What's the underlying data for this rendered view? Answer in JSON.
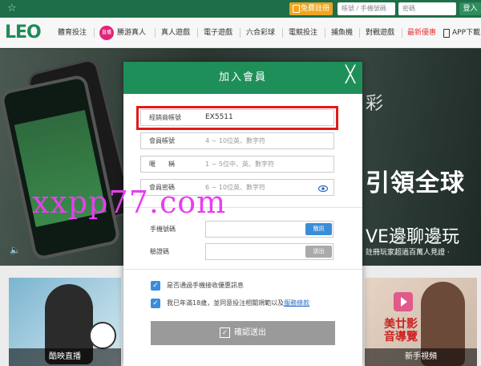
{
  "topbar": {
    "register_label": "免費註冊",
    "account_placeholder": "帳號 / 手機號碼",
    "password_placeholder": "密碼",
    "login_label": "登入",
    "star_icon": "star-icon"
  },
  "nav": {
    "logo": "LEO",
    "live_badge": "直播",
    "items": [
      "體育投注",
      "勝游真人",
      "真人遊戲",
      "電子遊戲",
      "六合彩球",
      "電競投注",
      "捕魚機",
      "對戰遊戲",
      "最新優惠",
      "APP下載"
    ]
  },
  "hero": {
    "peek_text": "彩",
    "slogan": "引領全球",
    "slogan_2": "VE邊聊邊玩",
    "footnote": "註冊玩家超過百萬人見證 ·"
  },
  "watermark": "xxpp77.com",
  "cards": {
    "left_label": "酷映直播",
    "right_label": "新手視頻",
    "right_promo": "美廿影音導覽"
  },
  "modal": {
    "title": "加入會員",
    "fields": {
      "agent_label": "經銷商帳號",
      "agent_value": "EX5511",
      "account_label": "會員帳號",
      "account_placeholder": "4 ~ 10位英、數字符",
      "nickname_label": "暱　　稱",
      "nickname_placeholder": "1 ~ 5位中、英、數字符",
      "password_label": "會員密碼",
      "password_placeholder": "6 ~ 10位英、數字符",
      "phone_label": "手機號碼",
      "sms_button": "簡訊",
      "code_label": "驗證碼",
      "send_button": "送出"
    },
    "checks": {
      "promo_text": "是否通過手機接收優惠訊息",
      "age_text_prefix": "我已年滿18歲，並同意投注相關規範以及",
      "age_link": "服務條款"
    },
    "submit_label": "確認送出"
  }
}
